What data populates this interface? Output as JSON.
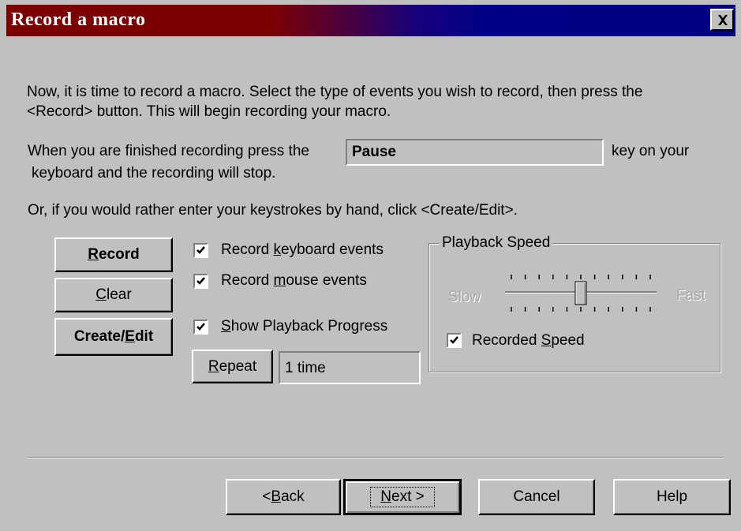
{
  "window": {
    "title": "Record a macro"
  },
  "intro": {
    "line1": "Now, it is time to record a macro.  Select the type of events you wish to record, then press the",
    "line2": "<Record> button.  This will begin recording your macro."
  },
  "finish": {
    "prefix": "When you are finished recording press the",
    "key_value": "Pause",
    "suffix": "key on your",
    "line2": "keyboard and the recording will stop."
  },
  "manual_text": "Or, if you would rather enter your keystrokes by hand, click <Create/Edit>.",
  "buttons": {
    "record": {
      "pre": "",
      "mnemonic": "R",
      "post": "ecord"
    },
    "clear": {
      "pre": "",
      "mnemonic": "C",
      "post": "lear"
    },
    "create_edit": {
      "pre": "Create/",
      "mnemonic": "E",
      "post": "dit"
    },
    "repeat": {
      "pre": "",
      "mnemonic": "R",
      "post": "epeat"
    }
  },
  "options": {
    "keyboard": {
      "pre": "Record ",
      "mnemonic": "k",
      "post": "eyboard events",
      "checked": true
    },
    "mouse": {
      "pre": "Record ",
      "mnemonic": "m",
      "post": "ouse events",
      "checked": true
    },
    "progress": {
      "pre": "",
      "mnemonic": "S",
      "post": "how Playback Progress",
      "checked": true
    }
  },
  "repeat_value": "1 time",
  "playback": {
    "label": "Playback Speed",
    "slow": "Slow",
    "fast": "Fast",
    "slider_value": 0.5,
    "recorded_speed": {
      "pre": "Recorded ",
      "mnemonic": "S",
      "post": "peed",
      "checked": true
    }
  },
  "footer": {
    "back": {
      "pre": "< ",
      "mnemonic": "B",
      "post": "ack"
    },
    "next": {
      "pre": "",
      "mnemonic": "N",
      "post": "ext >"
    },
    "cancel": "Cancel",
    "help": "Help"
  }
}
